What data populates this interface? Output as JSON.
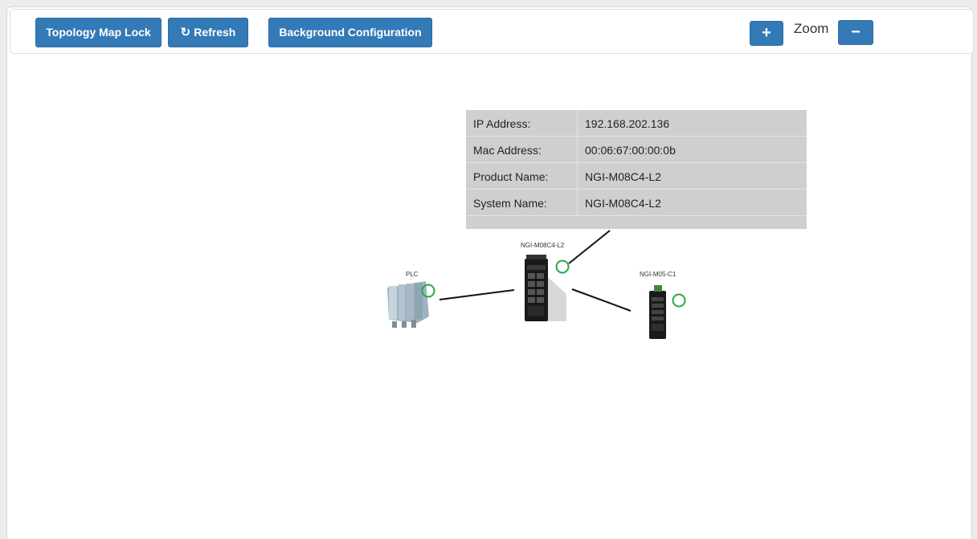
{
  "toolbar": {
    "lock_label": "Topology Map Lock",
    "refresh_label": "Refresh",
    "refresh_icon": "refresh-icon",
    "background_label": "Background Configuration",
    "zoom_in_label": "+",
    "zoom_label": "Zoom",
    "zoom_out_label": "−"
  },
  "tooltip": {
    "rows": [
      {
        "label": "IP Address:",
        "value": "192.168.202.136"
      },
      {
        "label": "Mac Address:",
        "value": "00:06:67:00:00:0b"
      },
      {
        "label": "Product Name:",
        "value": "NGI-M08C4-L2"
      },
      {
        "label": "System Name:",
        "value": "NGI-M08C4-L2"
      }
    ]
  },
  "nodes": {
    "plc": {
      "label": "PLC",
      "status_color": "#27a844"
    },
    "main_switch": {
      "label": "NGI-M08C4-L2",
      "status_color": "#27a844"
    },
    "edge_switch": {
      "label": "NGI-M05-C1",
      "status_color": "#27a844"
    }
  },
  "colors": {
    "primary": "#337ab7",
    "status_ok": "#27a844",
    "tooltip_bg": "#cfcfcf"
  }
}
